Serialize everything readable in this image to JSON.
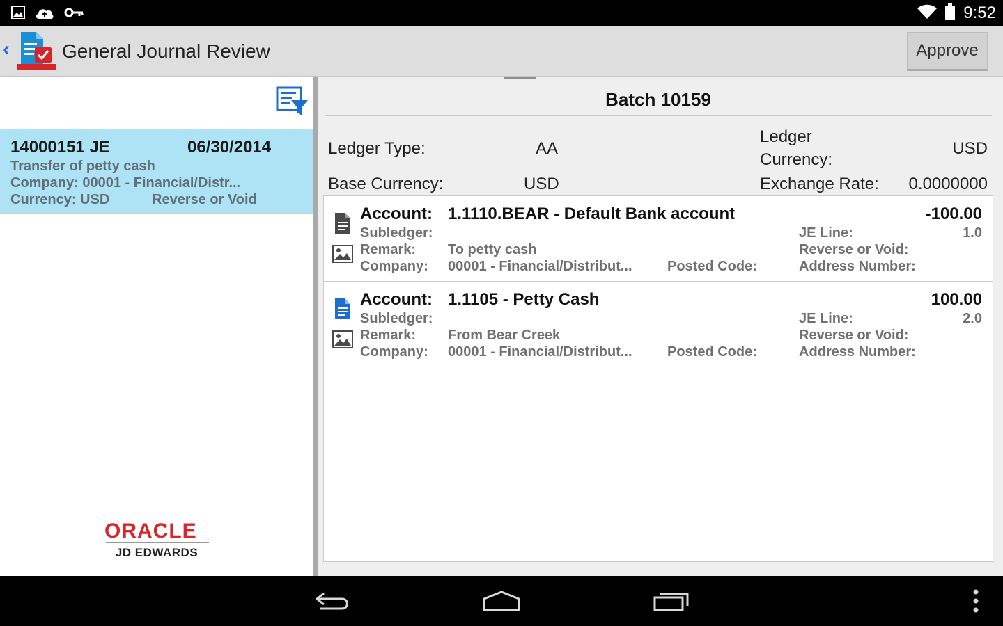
{
  "status_bar": {
    "time": "9:52",
    "left_icons": [
      "image-icon",
      "cloud-upload-icon",
      "key-icon"
    ],
    "right_icons": [
      "wifi-icon",
      "battery-icon"
    ]
  },
  "action_bar": {
    "title": "General Journal Review",
    "approve_label": "Approve",
    "app_icon_caption": "ORACLE"
  },
  "list": {
    "items": [
      {
        "doc_no": "14000151 JE",
        "date": "06/30/2014",
        "description": "Transfer of petty cash",
        "company": "Company: 00001 - Financial/Distr...",
        "currency": "Currency: USD",
        "status": "Reverse or Void"
      }
    ]
  },
  "branding": {
    "oracle": "ORACLE",
    "jde": "JD EDWARDS"
  },
  "batch": {
    "title": "Batch 10159",
    "ledger_type_label": "Ledger Type:",
    "ledger_type_value": "AA",
    "ledger_currency_label_1": "Ledger",
    "ledger_currency_label_2": "Currency:",
    "ledger_currency_value": "USD",
    "base_currency_label": "Base Currency:",
    "base_currency_value": "USD",
    "exchange_rate_label": "Exchange Rate:",
    "exchange_rate_value": "0.0000000"
  },
  "lines": [
    {
      "account_label": "Account:",
      "account": "1.1110.BEAR - Default Bank account",
      "amount": "-100.00",
      "subledger_label": "Subledger:",
      "remark_label": "Remark:",
      "remark": "To petty cash",
      "company_label": "Company:",
      "company": "00001 - Financial/Distribut...",
      "posted_code_label": "Posted Code:",
      "je_line_label": "JE Line:",
      "je_line": "1.0",
      "reverse_label": "Reverse or Void:",
      "address_label": "Address Number:",
      "doc_icon_color": "#4a4a4a"
    },
    {
      "account_label": "Account:",
      "account": "1.1105 - Petty Cash",
      "amount": "100.00",
      "subledger_label": "Subledger:",
      "remark_label": "Remark:",
      "remark": "From Bear Creek",
      "company_label": "Company:",
      "company": "00001 - Financial/Distribut...",
      "posted_code_label": "Posted Code:",
      "je_line_label": "JE Line:",
      "je_line": "2.0",
      "reverse_label": "Reverse or Void:",
      "address_label": "Address Number:",
      "doc_icon_color": "#1a6fd0"
    }
  ],
  "nav_bar": {
    "icons": [
      "back-icon",
      "home-icon",
      "recent-apps-icon",
      "overflow-menu-icon"
    ]
  },
  "colors": {
    "selected_row": "#aee3f6",
    "accent_blue": "#1a6fd0",
    "oracle_red": "#d5262b"
  }
}
